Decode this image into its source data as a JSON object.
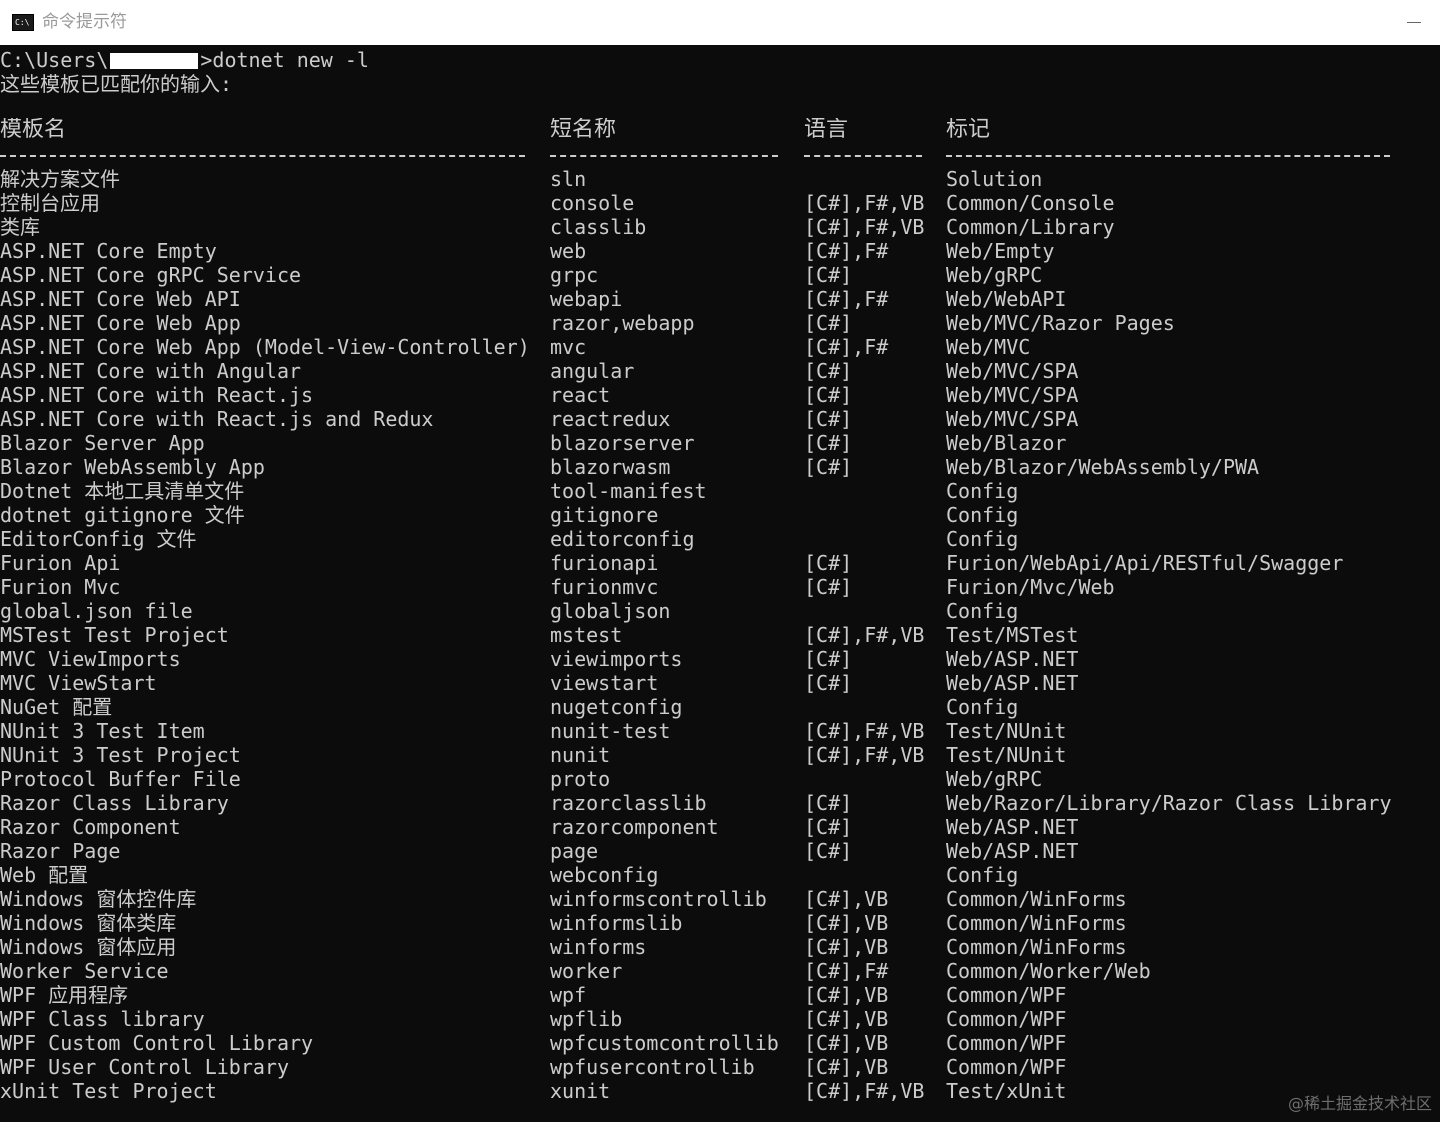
{
  "window": {
    "title": "命令提示符",
    "icon": "C:\\"
  },
  "console": {
    "prompt_prefix": "C:\\Users\\",
    "prompt_suffix": ">dotnet new -l",
    "match_text": "这些模板已匹配你的输入:",
    "headers": [
      "模板名",
      "短名称",
      "语言",
      "标记"
    ],
    "rows": [
      [
        "解决方案文件",
        "sln",
        "",
        "Solution"
      ],
      [
        "控制台应用",
        "console",
        "[C#],F#,VB",
        "Common/Console"
      ],
      [
        "类库",
        "classlib",
        "[C#],F#,VB",
        "Common/Library"
      ],
      [
        "ASP.NET Core Empty",
        "web",
        "[C#],F#",
        "Web/Empty"
      ],
      [
        "ASP.NET Core gRPC Service",
        "grpc",
        "[C#]",
        "Web/gRPC"
      ],
      [
        "ASP.NET Core Web API",
        "webapi",
        "[C#],F#",
        "Web/WebAPI"
      ],
      [
        "ASP.NET Core Web App",
        "razor,webapp",
        "[C#]",
        "Web/MVC/Razor Pages"
      ],
      [
        "ASP.NET Core Web App (Model-View-Controller)",
        "mvc",
        "[C#],F#",
        "Web/MVC"
      ],
      [
        "ASP.NET Core with Angular",
        "angular",
        "[C#]",
        "Web/MVC/SPA"
      ],
      [
        "ASP.NET Core with React.js",
        "react",
        "[C#]",
        "Web/MVC/SPA"
      ],
      [
        "ASP.NET Core with React.js and Redux",
        "reactredux",
        "[C#]",
        "Web/MVC/SPA"
      ],
      [
        "Blazor Server App",
        "blazorserver",
        "[C#]",
        "Web/Blazor"
      ],
      [
        "Blazor WebAssembly App",
        "blazorwasm",
        "[C#]",
        "Web/Blazor/WebAssembly/PWA"
      ],
      [
        "Dotnet 本地工具清单文件",
        "tool-manifest",
        "",
        "Config"
      ],
      [
        "dotnet gitignore 文件",
        "gitignore",
        "",
        "Config"
      ],
      [
        "EditorConfig 文件",
        "editorconfig",
        "",
        "Config"
      ],
      [
        "Furion Api",
        "furionapi",
        "[C#]",
        "Furion/WebApi/Api/RESTful/Swagger"
      ],
      [
        "Furion Mvc",
        "furionmvc",
        "[C#]",
        "Furion/Mvc/Web"
      ],
      [
        "global.json file",
        "globaljson",
        "",
        "Config"
      ],
      [
        "MSTest Test Project",
        "mstest",
        "[C#],F#,VB",
        "Test/MSTest"
      ],
      [
        "MVC ViewImports",
        "viewimports",
        "[C#]",
        "Web/ASP.NET"
      ],
      [
        "MVC ViewStart",
        "viewstart",
        "[C#]",
        "Web/ASP.NET"
      ],
      [
        "NuGet 配置",
        "nugetconfig",
        "",
        "Config"
      ],
      [
        "NUnit 3 Test Item",
        "nunit-test",
        "[C#],F#,VB",
        "Test/NUnit"
      ],
      [
        "NUnit 3 Test Project",
        "nunit",
        "[C#],F#,VB",
        "Test/NUnit"
      ],
      [
        "Protocol Buffer File",
        "proto",
        "",
        "Web/gRPC"
      ],
      [
        "Razor Class Library",
        "razorclasslib",
        "[C#]",
        "Web/Razor/Library/Razor Class Library"
      ],
      [
        "Razor Component",
        "razorcomponent",
        "[C#]",
        "Web/ASP.NET"
      ],
      [
        "Razor Page",
        "page",
        "[C#]",
        "Web/ASP.NET"
      ],
      [
        "Web 配置",
        "webconfig",
        "",
        "Config"
      ],
      [
        "Windows 窗体控件库",
        "winformscontrollib",
        "[C#],VB",
        "Common/WinForms"
      ],
      [
        "Windows 窗体类库",
        "winformslib",
        "[C#],VB",
        "Common/WinForms"
      ],
      [
        "Windows 窗体应用",
        "winforms",
        "[C#],VB",
        "Common/WinForms"
      ],
      [
        "Worker Service",
        "worker",
        "[C#],F#",
        "Common/Worker/Web"
      ],
      [
        "WPF 应用程序",
        "wpf",
        "[C#],VB",
        "Common/WPF"
      ],
      [
        "WPF Class library",
        "wpflib",
        "[C#],VB",
        "Common/WPF"
      ],
      [
        "WPF Custom Control Library",
        "wpfcustomcontrollib",
        "[C#],VB",
        "Common/WPF"
      ],
      [
        "WPF User Control Library",
        "wpfusercontrollib",
        "[C#],VB",
        "Common/WPF"
      ],
      [
        "xUnit Test Project",
        "xunit",
        "[C#],F#,VB",
        "Test/xUnit"
      ]
    ]
  },
  "watermark": "@稀土掘金技术社区",
  "colors": {
    "background": "#0c0c0c",
    "text": "#cccccc",
    "titlebar": "#ffffff"
  }
}
